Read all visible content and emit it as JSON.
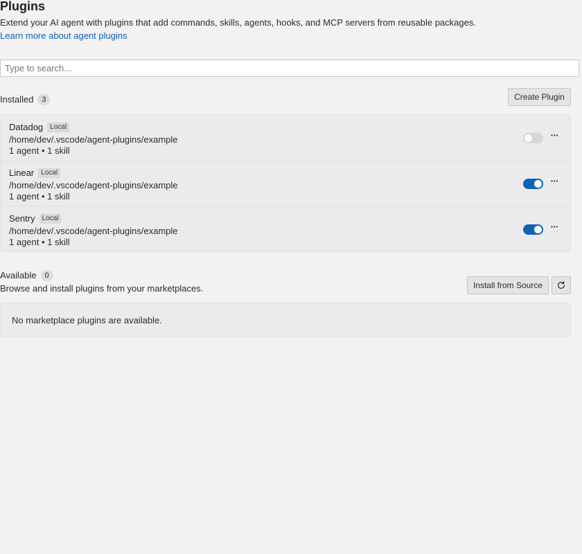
{
  "header": {
    "title": "Plugins",
    "description": "Extend your AI agent with plugins that add commands, skills, agents, hooks, and MCP servers from reusable packages.",
    "learn_more": "Learn more about agent plugins"
  },
  "search": {
    "placeholder": "Type to search...",
    "value": ""
  },
  "installed": {
    "label": "Installed",
    "count": "3",
    "create_button": "Create Plugin",
    "plugins": [
      {
        "name": "Datadog",
        "tag": "Local",
        "path": "/home/dev/.vscode/agent-plugins/example",
        "meta": "1 agent • 1 skill",
        "enabled": false
      },
      {
        "name": "Linear",
        "tag": "Local",
        "path": "/home/dev/.vscode/agent-plugins/example",
        "meta": "1 agent • 1 skill",
        "enabled": true
      },
      {
        "name": "Sentry",
        "tag": "Local",
        "path": "/home/dev/.vscode/agent-plugins/example",
        "meta": "1 agent • 1 skill",
        "enabled": true
      }
    ],
    "more_glyph": "···"
  },
  "available": {
    "label": "Available",
    "count": "0",
    "subtitle": "Browse and install plugins from your marketplaces.",
    "install_button": "Install from Source",
    "empty_text": "No marketplace plugins are available."
  },
  "colors": {
    "accent": "#0f63b5",
    "background": "#f2f2f2"
  },
  "icons": {
    "refresh": "refresh-icon",
    "more": "more-icon"
  }
}
